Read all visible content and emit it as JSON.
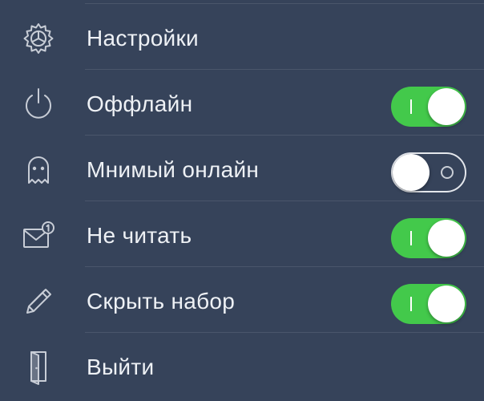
{
  "menu": {
    "items": [
      {
        "label": "Настройки",
        "icon": "gear-icon"
      },
      {
        "label": "Оффлайн",
        "icon": "power-icon",
        "toggle": true
      },
      {
        "label": "Мнимый онлайн",
        "icon": "ghost-icon",
        "toggle": false
      },
      {
        "label": "Не читать",
        "icon": "envelope-badge-icon",
        "toggle": true
      },
      {
        "label": "Скрыть набор",
        "icon": "pencil-icon",
        "toggle": true
      },
      {
        "label": "Выйти",
        "icon": "exit-door-icon"
      }
    ]
  },
  "colors": {
    "background": "#36435a",
    "separator": "#4a566b",
    "toggle_on": "#43c94b",
    "text": "#eef1f5",
    "icon": "#c8cdd6"
  }
}
